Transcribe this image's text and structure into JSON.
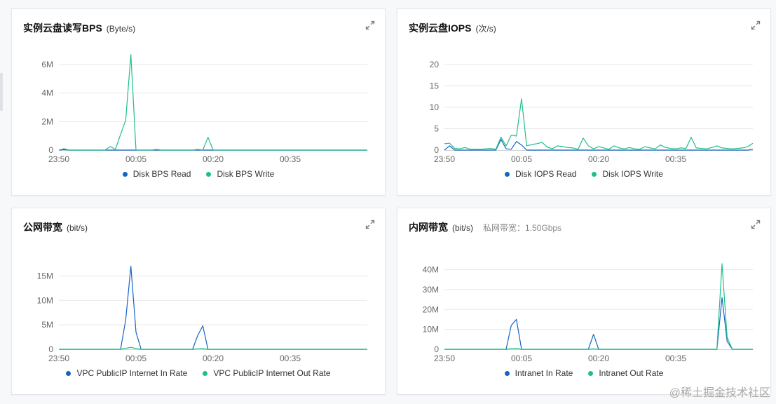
{
  "colors": {
    "read": "#1565c0",
    "write": "#1dbf8a",
    "grid": "#e6e7e9",
    "axis": "#cfd3d8",
    "tick": "#666666"
  },
  "panels": [
    {
      "title": "实例云盘读写BPS",
      "unit": "(Byte/s)",
      "extra": "",
      "expand_icon": "expand-arrows-icon",
      "chart_data": {
        "type": "line",
        "x_ticks": [
          "23:50",
          "00:05",
          "00:20",
          "00:35"
        ],
        "y_ticks": [
          "0",
          "2M",
          "4M",
          "6M"
        ],
        "ylim": [
          0,
          6000000
        ],
        "grid": true,
        "legend_position": "bottom",
        "series": [
          {
            "name": "Disk BPS Read",
            "color": "#1565c0",
            "values": [
              0,
              30000,
              0,
              0,
              0,
              0,
              0,
              0,
              0,
              0,
              0,
              0,
              0,
              0,
              0,
              0,
              0,
              0,
              0,
              0,
              0,
              0,
              0,
              0,
              0,
              0,
              0,
              0,
              0,
              0,
              0,
              0,
              0,
              0,
              0,
              0,
              0,
              0,
              0,
              0,
              0,
              0,
              0,
              0,
              0,
              0,
              0,
              0,
              0,
              0,
              0,
              0,
              0,
              0,
              0,
              0,
              0,
              0,
              0,
              0,
              0
            ]
          },
          {
            "name": "Disk BPS Write",
            "color": "#1dbf8a",
            "values": [
              0,
              100000,
              0,
              0,
              0,
              0,
              0,
              0,
              0,
              0,
              250000,
              50000,
              1100000,
              2100000,
              6700000,
              0,
              0,
              0,
              0,
              50000,
              0,
              0,
              0,
              0,
              0,
              0,
              0,
              50000,
              0,
              900000,
              0,
              0,
              0,
              0,
              0,
              0,
              0,
              0,
              0,
              0,
              0,
              0,
              0,
              0,
              0,
              0,
              0,
              0,
              0,
              0,
              0,
              0,
              0,
              0,
              0,
              0,
              0,
              0,
              0,
              0,
              0
            ]
          }
        ]
      }
    },
    {
      "title": "实例云盘IOPS",
      "unit": "(次/s)",
      "extra": "",
      "expand_icon": "expand-arrows-icon",
      "chart_data": {
        "type": "line",
        "x_ticks": [
          "23:50",
          "00:05",
          "00:20",
          "00:35"
        ],
        "y_ticks": [
          "0",
          "5",
          "10",
          "15",
          "20"
        ],
        "ylim": [
          0,
          20
        ],
        "grid": true,
        "legend_position": "bottom",
        "series": [
          {
            "name": "Disk IOPS Read",
            "color": "#1565c0",
            "values": [
              0,
              1,
              0,
              0,
              0,
              0,
              0,
              0,
              0,
              0,
              0,
              2.5,
              0.3,
              0.2,
              2,
              1.2,
              0,
              0,
              0,
              0,
              0,
              0,
              0,
              0,
              0,
              0,
              0,
              0,
              0,
              0,
              0,
              0,
              0,
              0,
              0,
              0,
              0,
              0,
              0,
              0,
              0,
              0,
              0,
              0,
              0,
              0,
              0,
              0,
              0,
              0,
              0,
              0,
              0,
              0,
              0,
              0,
              0,
              0,
              0,
              0,
              0.2
            ]
          },
          {
            "name": "Disk IOPS Write",
            "color": "#1dbf8a",
            "values": [
              1.5,
              1.6,
              0.4,
              0.3,
              0.6,
              0.2,
              0.2,
              0.2,
              0.3,
              0.4,
              0.2,
              3,
              1,
              3.5,
              3.3,
              12,
              1,
              1.3,
              1.5,
              1.8,
              0.7,
              0.3,
              1,
              0.8,
              0.6,
              0.5,
              0.2,
              2.8,
              1,
              0.3,
              0.8,
              0.5,
              0.2,
              1,
              0.5,
              0.3,
              0.6,
              0.3,
              0.2,
              0.8,
              0.5,
              0.3,
              1.2,
              0.6,
              0.4,
              0.3,
              0.5,
              0.4,
              3,
              0.5,
              0.4,
              0.3,
              0.6,
              1,
              0.5,
              0.4,
              0.3,
              0.4,
              0.5,
              0.8,
              1.6
            ]
          }
        ]
      }
    },
    {
      "title": "公网带宽",
      "unit": "(bit/s)",
      "extra": "",
      "expand_icon": "expand-arrows-icon",
      "chart_data": {
        "type": "line",
        "x_ticks": [
          "23:50",
          "00:05",
          "00:20",
          "00:35"
        ],
        "y_ticks": [
          "0",
          "5M",
          "10M",
          "15M"
        ],
        "ylim": [
          0,
          17500000
        ],
        "grid": true,
        "legend_position": "bottom",
        "series": [
          {
            "name": "VPC PublicIP Internet In Rate",
            "color": "#1565c0",
            "values": [
              0,
              0,
              0,
              0,
              0,
              0,
              0,
              0,
              0,
              0,
              0,
              0,
              0,
              6000000,
              17000000,
              3500000,
              0,
              0,
              0,
              0,
              0,
              0,
              0,
              0,
              0,
              0,
              0,
              2800000,
              4800000,
              0,
              0,
              0,
              0,
              0,
              0,
              0,
              0,
              0,
              0,
              0,
              0,
              0,
              0,
              0,
              0,
              0,
              0,
              0,
              0,
              0,
              0,
              0,
              0,
              0,
              0,
              0,
              0,
              0,
              0,
              0,
              0
            ]
          },
          {
            "name": "VPC PublicIP Internet Out Rate",
            "color": "#1dbf8a",
            "values": [
              0,
              0,
              0,
              0,
              0,
              0,
              0,
              0,
              0,
              0,
              0,
              0,
              0,
              200000,
              400000,
              150000,
              0,
              0,
              0,
              0,
              0,
              0,
              0,
              0,
              0,
              0,
              0,
              100000,
              150000,
              0,
              0,
              0,
              0,
              0,
              0,
              0,
              0,
              0,
              0,
              0,
              0,
              0,
              0,
              0,
              0,
              0,
              0,
              0,
              0,
              0,
              0,
              0,
              0,
              0,
              0,
              0,
              0,
              0,
              0,
              0,
              0
            ]
          }
        ]
      }
    },
    {
      "title": "内网带宽",
      "unit": "(bit/s)",
      "extra": "私网带宽：1.50Gbps",
      "expand_icon": "expand-arrows-icon",
      "chart_data": {
        "type": "line",
        "x_ticks": [
          "23:50",
          "00:05",
          "00:20",
          "00:35"
        ],
        "y_ticks": [
          "0",
          "10M",
          "20M",
          "30M",
          "40M"
        ],
        "ylim": [
          0,
          43000000
        ],
        "grid": true,
        "legend_position": "bottom",
        "series": [
          {
            "name": "Intranet In Rate",
            "color": "#1565c0",
            "values": [
              0,
              0,
              0,
              0,
              0,
              0,
              0,
              0,
              0,
              0,
              0,
              0,
              0,
              12000000,
              15000000,
              0,
              0,
              0,
              0,
              0,
              0,
              0,
              0,
              0,
              0,
              0,
              0,
              0,
              0,
              7500000,
              0,
              0,
              0,
              0,
              0,
              0,
              0,
              0,
              0,
              0,
              0,
              0,
              0,
              0,
              0,
              0,
              0,
              0,
              0,
              0,
              0,
              0,
              0,
              0,
              26000000,
              4000000,
              0,
              0,
              0,
              0,
              0
            ]
          },
          {
            "name": "Intranet Out Rate",
            "color": "#1dbf8a",
            "values": [
              0,
              0,
              0,
              0,
              0,
              0,
              0,
              0,
              0,
              0,
              0,
              0,
              0,
              300000,
              500000,
              0,
              0,
              0,
              0,
              0,
              0,
              0,
              0,
              0,
              0,
              0,
              0,
              0,
              0,
              200000,
              0,
              0,
              0,
              0,
              0,
              0,
              0,
              0,
              0,
              0,
              0,
              0,
              0,
              0,
              0,
              0,
              0,
              0,
              0,
              0,
              0,
              0,
              0,
              0,
              43000000,
              6000000,
              0,
              0,
              0,
              0,
              0
            ]
          }
        ]
      }
    }
  ],
  "watermark": "@稀土掘金技术社区"
}
